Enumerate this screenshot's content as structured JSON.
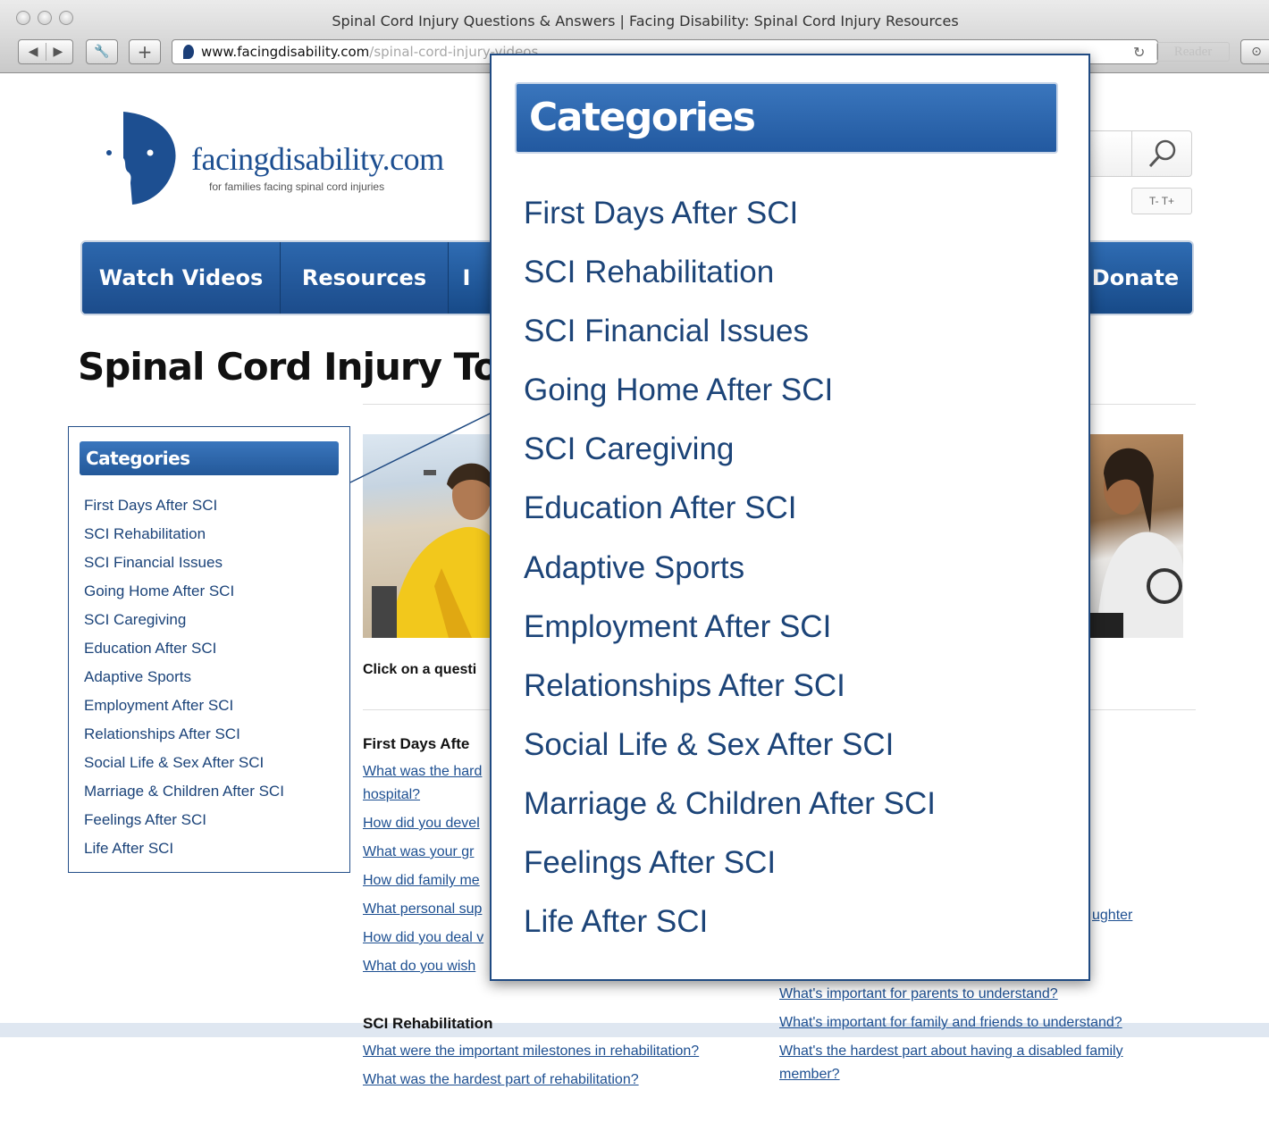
{
  "window": {
    "title": "Spinal Cord Injury Questions & Answers | Facing Disability: Spinal Cord Injury Resources"
  },
  "toolbar": {
    "url_host": "www.facingdisability.com",
    "url_path": "/spinal-cord-injury-videos",
    "reader_label": "Reader"
  },
  "site": {
    "logo_name": "facingdisability.com",
    "tagline": "for families facing spinal cord injuries",
    "text_size_label": "T- T+"
  },
  "nav": {
    "items": [
      "Watch Videos",
      "Resources",
      "I",
      "Donate"
    ]
  },
  "page_title": "Spinal Cord Injury Topic",
  "sidebar": {
    "heading": "Categories",
    "items": [
      "First Days After SCI",
      "SCI Rehabilitation",
      "SCI Financial Issues",
      "Going Home After SCI",
      "SCI Caregiving",
      "Education After SCI",
      "Adaptive Sports",
      "Employment After SCI",
      "Relationships After SCI",
      "Social Life & Sex After SCI",
      "Marriage & Children After SCI",
      "Feelings After SCI",
      "Life After SCI"
    ]
  },
  "content": {
    "instruction": "Click on a questi",
    "section1_title": "First Days Afte",
    "section1_links": [
      "What was the hard",
      "hospital?",
      "How did you devel",
      "What was your gr",
      "How did family me",
      "What personal sup",
      "How did you deal v",
      "What do you wish"
    ],
    "right_fragment": "ughter",
    "right_links": [
      "What's important for parents to understand?",
      "What's important for family and friends to understand?",
      "What's the hardest part about having a disabled family",
      "member?"
    ],
    "section2_title": "SCI Rehabilitation",
    "section2_links": [
      "What were the important milestones in rehabilitation?",
      "What was the hardest part of rehabilitation?"
    ]
  },
  "popup": {
    "heading": "Categories",
    "items": [
      "First Days After SCI",
      "SCI Rehabilitation",
      "SCI Financial Issues",
      "Going Home After SCI",
      "SCI Caregiving",
      "Education After SCI",
      "Adaptive Sports",
      "Employment After SCI",
      "Relationships After SCI",
      "Social Life & Sex After SCI",
      "Marriage & Children After SCI",
      "Feelings After SCI",
      "Life After SCI"
    ]
  },
  "colors": {
    "brand_blue": "#1d4f91",
    "nav_blue": "#2f6cb3",
    "link_blue": "#1c4478"
  }
}
